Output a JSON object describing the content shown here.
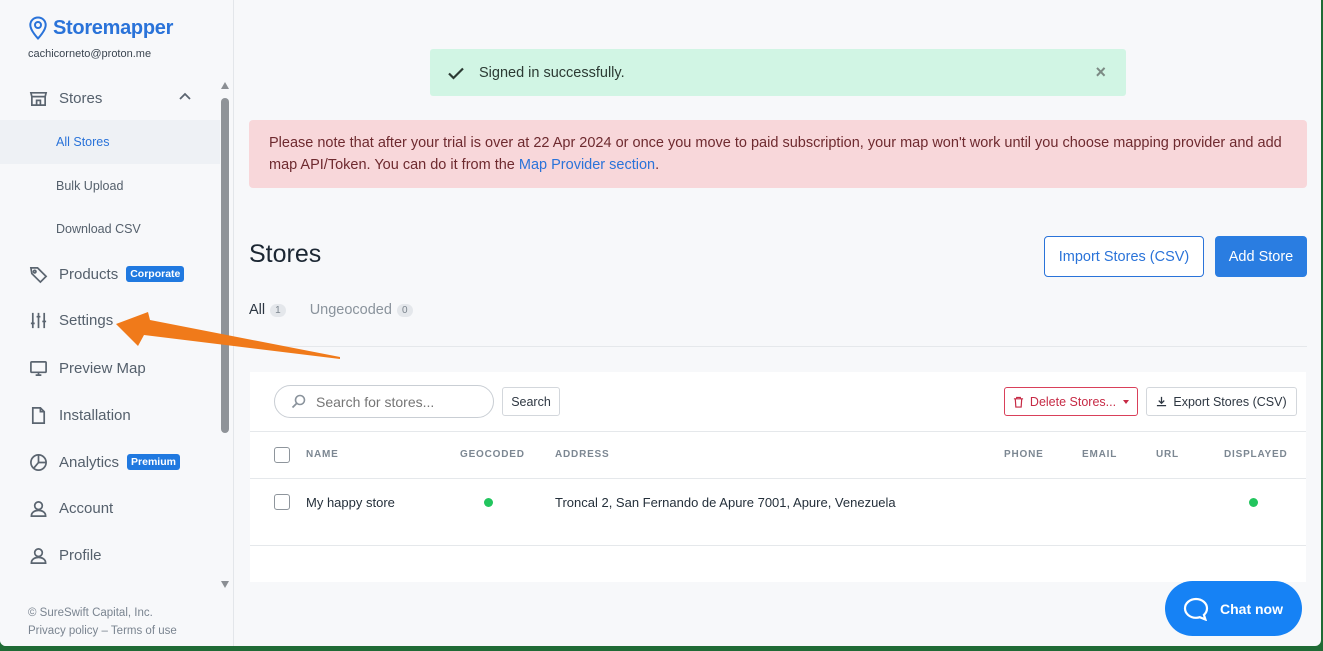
{
  "brand": {
    "name": "Storemapper",
    "email": "cachicorneto@proton.me"
  },
  "nav": {
    "stores": "Stores",
    "all_stores": "All Stores",
    "bulk_upload": "Bulk Upload",
    "download_csv": "Download CSV",
    "products": "Products",
    "products_badge": "Corporate",
    "settings": "Settings",
    "preview_map": "Preview Map",
    "installation": "Installation",
    "analytics": "Analytics",
    "analytics_badge": "Premium",
    "account": "Account",
    "profile": "Profile"
  },
  "footer": {
    "copyright": "© SureSwift Capital, Inc.",
    "privacy": "Privacy policy",
    "sep": "–",
    "terms": "Terms of use"
  },
  "toast": {
    "message": "Signed in successfully.",
    "close": "×"
  },
  "alert": {
    "text": "Please note that after your trial is over at 22 Apr 2024 or once you move to paid subscription, your map won't work until you choose mapping provider and add map API/Token. You can do it from the ",
    "link": "Map Provider section",
    "end": "."
  },
  "page": {
    "title": "Stores",
    "import_button": "Import Stores (CSV)",
    "add_button": "Add Store"
  },
  "tabs": [
    {
      "label": "All",
      "count": "1"
    },
    {
      "label": "Ungeocoded",
      "count": "0"
    }
  ],
  "toolbar": {
    "search_placeholder": "Search for stores...",
    "search_button": "Search",
    "delete_button": "Delete Stores...",
    "export_button": "Export Stores (CSV)"
  },
  "table": {
    "headers": {
      "name": "NAME",
      "geocoded": "GEOCODED",
      "address": "ADDRESS",
      "phone": "PHONE",
      "email": "EMAIL",
      "url": "URL",
      "displayed": "DISPLAYED"
    },
    "rows": [
      {
        "name": "My happy store",
        "geocoded": true,
        "address": "Troncal 2, San Fernando de Apure 7001, Apure, Venezuela",
        "phone": "",
        "email": "",
        "url": "",
        "displayed": true
      }
    ]
  },
  "chat": {
    "label": "Chat now"
  },
  "colors": {
    "accent": "#2a73d9",
    "success_bg": "#d1f5e4",
    "alert_bg": "#f8d7da",
    "status_dot": "#22c55e",
    "annotation_arrow": "#f07a1a"
  }
}
